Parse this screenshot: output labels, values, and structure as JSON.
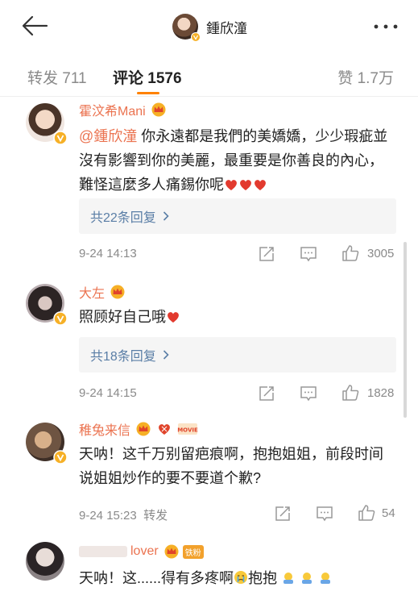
{
  "header": {
    "title": "鍾欣潼"
  },
  "tabs": {
    "repost": "转发 711",
    "comments": "评论 1576",
    "likes": "赞 1.7万"
  },
  "comments": [
    {
      "user": "霍汶希Mani",
      "mention": "@鍾欣潼",
      "text": " 你永遠都是我們的美嬌嬌，少少瑕疵並沒有影響到你的美麗，最重要是你善良的內心，難怪這麼多人痛錫你呢",
      "replies": "共22条回复",
      "time": "9-24 14:13",
      "likes": "3005"
    },
    {
      "user": "大左",
      "text": "照顾好自己哦",
      "replies": "共18条回复",
      "time": "9-24 14:15",
      "likes": "1828"
    },
    {
      "user": "稚兔来信",
      "badge": "MOVIE",
      "text": "天呐！这千万别留疤痕啊，抱抱姐姐，前段时间说姐姐炒作的要不要道个歉?",
      "time": "9-24 15:23",
      "repost": "转发",
      "likes": "54"
    },
    {
      "user": "lover",
      "fan_badge": "铁粉",
      "text": "天呐！这......得有多疼啊",
      "text2": "抱抱"
    }
  ]
}
